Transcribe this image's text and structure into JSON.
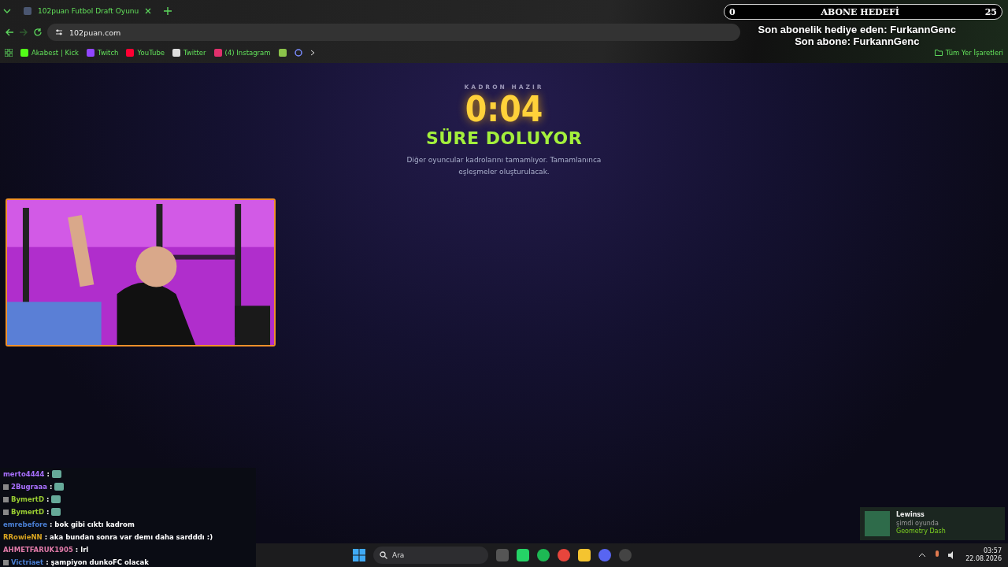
{
  "browser": {
    "tab_title": "102puan Futbol Draft Oyunu",
    "url": "102puan.com",
    "bookmarks": [
      {
        "label": "Akabest | Kick",
        "kind": "kick"
      },
      {
        "label": "Twitch",
        "kind": "twitch"
      },
      {
        "label": "YouTube",
        "kind": "youtube"
      },
      {
        "label": "Twitter",
        "kind": "x"
      },
      {
        "label": "(4) Instagram",
        "kind": "instagram"
      }
    ],
    "all_bookmarks": "Tüm Yer İşaretleri"
  },
  "page": {
    "eyebrow": "KADRON HAZIR",
    "timer": "0:04",
    "status": "SÜRE DOLUYOR",
    "message": "Diğer oyuncular kadrolarını tamamlıyor. Tamamlanınca eşleşmeler oluşturulacak."
  },
  "overlay": {
    "goal_current": "0",
    "goal_title": "ABONE HEDEFİ",
    "goal_target": "25",
    "last_gift": "Son abonelik hediye eden: FurkannGenc",
    "last_sub": "Son abone: FurkannGenc"
  },
  "chat": [
    {
      "user": "merto4444",
      "separator": ":",
      "color": "#a970ff",
      "kind": "emote",
      "badge": false
    },
    {
      "user": "2Bugraaa",
      "separator": ":",
      "color": "#a970ff",
      "kind": "emote",
      "badge": true
    },
    {
      "user": "BymertD",
      "separator": ":",
      "color": "#9acd32",
      "kind": "emote",
      "badge": true
    },
    {
      "user": "BymertD",
      "separator": ":",
      "color": "#9acd32",
      "kind": "emote",
      "badge": true
    },
    {
      "user": "emrebefore",
      "separator": ":",
      "color": "#4a7fd4",
      "kind": "text",
      "badge": false,
      "message": "bok gibi cıktı kadrom"
    },
    {
      "user": "RRowieNN",
      "separator": ":",
      "color": "#daa520",
      "kind": "text",
      "badge": false,
      "message": "aka bundan sonra var demı daha sardddı :)"
    },
    {
      "user": "AHMETFARUK1905",
      "separator": ":",
      "color": "#e07aa8",
      "kind": "text",
      "badge": false,
      "message": "lrl"
    },
    {
      "user": "Victriaet",
      "separator": ":",
      "color": "#4a7fd4",
      "kind": "text",
      "badge": true,
      "message": "şampiyon dunkoFC olacak"
    }
  ],
  "now_playing": {
    "name": "Lewinss",
    "status": "şimdi oyunda",
    "game": "Geometry Dash"
  },
  "taskbar": {
    "search_placeholder": "Ara",
    "time": "03:57",
    "date": "22.08.2026"
  }
}
